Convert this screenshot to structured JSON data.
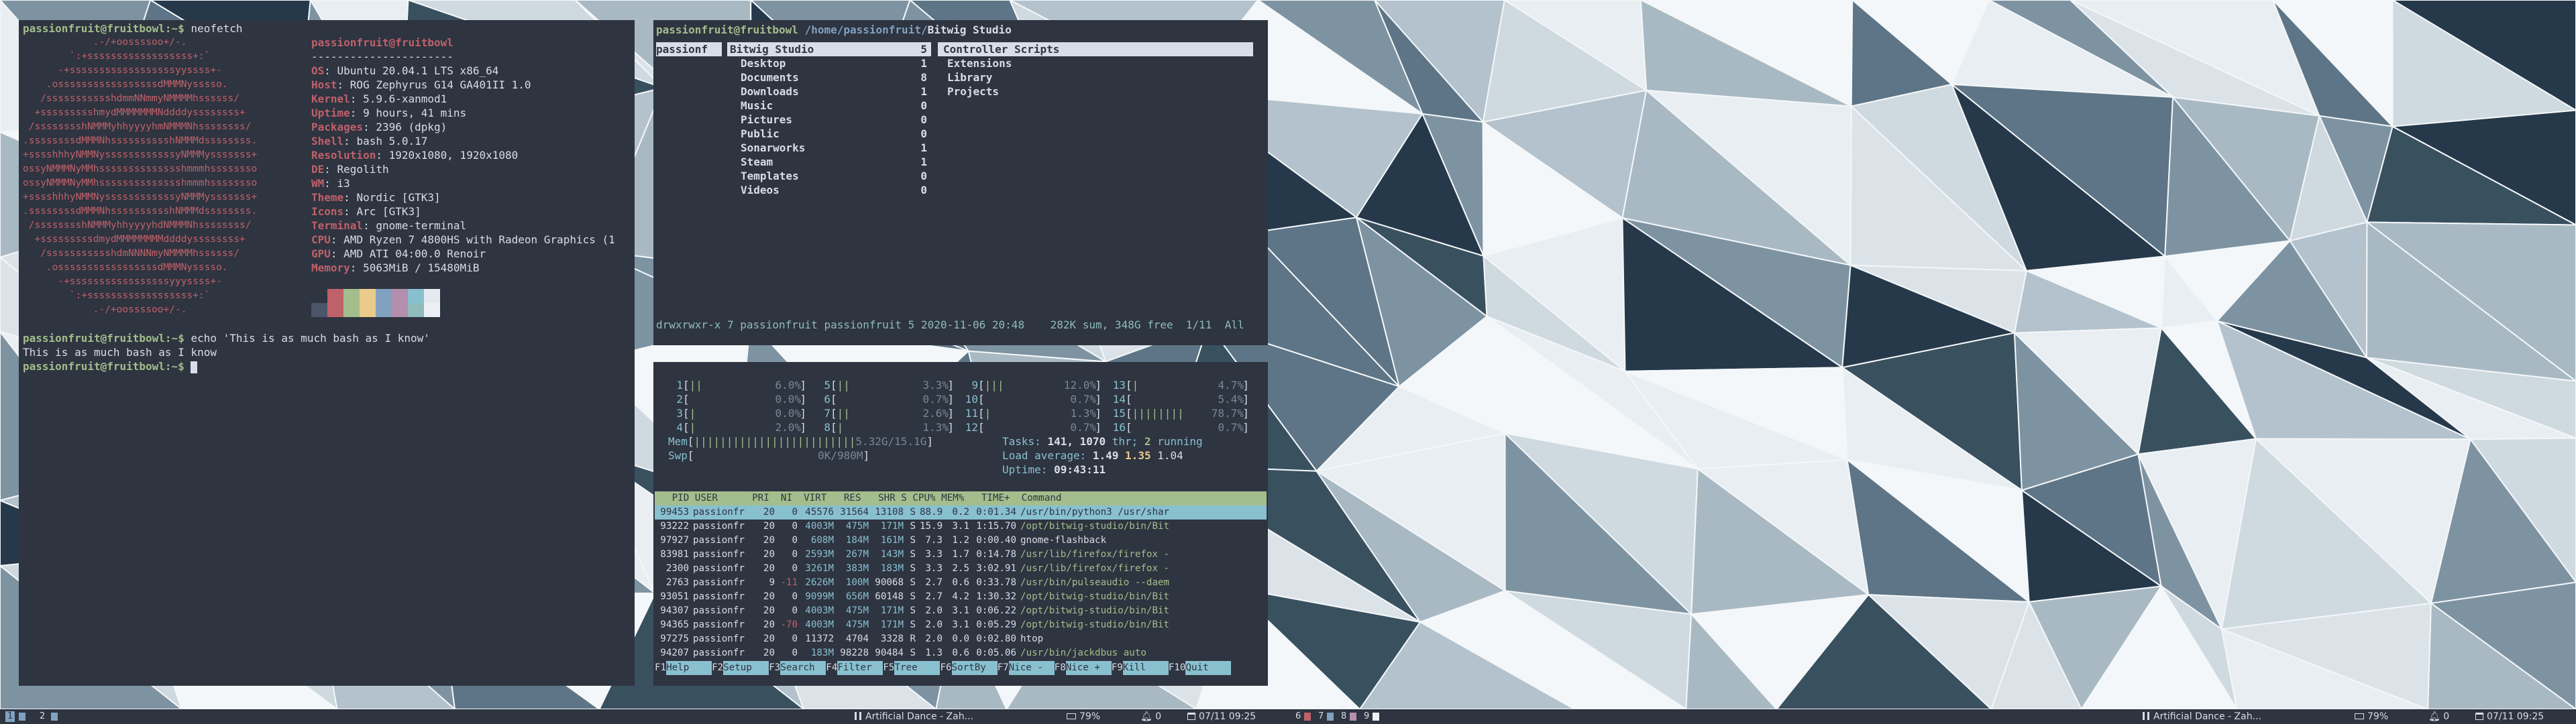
{
  "colors": {
    "bg": "#2e3440",
    "fg": "#d8dee9",
    "green": "#a3be8c",
    "red": "#bf616a",
    "cyan": "#88c0d0",
    "blue": "#81a1c1",
    "yellow": "#ebcb8b",
    "magenta": "#b48ead"
  },
  "terminal": {
    "prompt": "passionfruit@fruitbowl:~$ ",
    "cmd1": "neofetch",
    "logo": [
      "            .-/+oossssoo+/-.",
      "        `:+ssssssssssssssssss+:`",
      "      -+ssssssssssssssssssyyssss+-",
      "    .osssssssssssssssssdMMMNysssso.",
      "   /ssssssssssshdmmNNmmyNMMMMhssssss/",
      "  +ssssssssshmydMMMMMMMNddddyssssssss+",
      " /sssssssshNMMMyhhyyyyhmNMMMNhssssssss/",
      ".ssssssssdMMMNhsssssssssshNMMMdssssssss.",
      "+sssshhhyNMMNyssssssssssssyNMMMysssssss+",
      "ossyNMMMNyMMhsssssssssssssshmmmhssssssso",
      "ossyNMMMNyMMhsssssssssssssshmmmhssssssso",
      "+sssshhhyNMMNyssssssssssssyNMMMysssssss+",
      ".ssssssssdMMMNhsssssssssshNMMMdssssssss.",
      " /sssssssshNMMMyhhyyyyhdNMMMNhssssssss/",
      "  +sssssssssdmydMMMMMMMMddddyssssssss+",
      "   /ssssssssssshdmNNNNmyNMMMMhssssss/",
      "    .osssssssssssssssssdMMMNysssso.",
      "      -+sssssssssssssssssyyyssss+-",
      "        `:+ssssssssssssssssss+:`",
      "            .-/+oossssoo+/-."
    ],
    "header": "passionfruit@fruitbowl",
    "separator": "----------------------",
    "info": [
      {
        "key": "OS",
        "value": "Ubuntu 20.04.1 LTS x86_64"
      },
      {
        "key": "Host",
        "value": "ROG Zephyrus G14 GA401II 1.0"
      },
      {
        "key": "Kernel",
        "value": "5.9.6-xanmod1"
      },
      {
        "key": "Uptime",
        "value": "9 hours, 41 mins"
      },
      {
        "key": "Packages",
        "value": "2396 (dpkg)"
      },
      {
        "key": "Shell",
        "value": "bash 5.0.17"
      },
      {
        "key": "Resolution",
        "value": "1920x1080, 1920x1080"
      },
      {
        "key": "DE",
        "value": "Regolith"
      },
      {
        "key": "WM",
        "value": "i3"
      },
      {
        "key": "Theme",
        "value": "Nordic [GTK3]"
      },
      {
        "key": "Icons",
        "value": "Arc [GTK3]"
      },
      {
        "key": "Terminal",
        "value": "gnome-terminal"
      },
      {
        "key": "CPU",
        "value": "AMD Ryzen 7 4800HS with Radeon Graphics (1"
      },
      {
        "key": "GPU",
        "value": "AMD ATI 04:00.0 Renoir"
      },
      {
        "key": "Memory",
        "value": "5063MiB / 15480MiB"
      }
    ],
    "palette_top": [
      "#2e3440",
      "#bf616a",
      "#a3be8c",
      "#ebcb8b",
      "#81a1c1",
      "#b48ead",
      "#88c0d0",
      "#e5e9f0"
    ],
    "palette_bottom": [
      "#4c566a",
      "#bf616a",
      "#a3be8c",
      "#ebcb8b",
      "#81a1c1",
      "#b48ead",
      "#8fbcbb",
      "#eceff4"
    ],
    "cmd2": "echo 'This is as much bash as I know'",
    "output2": "This is as much bash as I know"
  },
  "ranger": {
    "title_host": "passionfruit@fruitbowl",
    "title_path": "/home/passionfruit/",
    "title_sel": "Bitwig Studio",
    "col1": "passionf",
    "col2": [
      {
        "name": "Bitwig Studio",
        "count": "5"
      },
      {
        "name": "Desktop",
        "count": "1"
      },
      {
        "name": "Documents",
        "count": "8"
      },
      {
        "name": "Downloads",
        "count": "1"
      },
      {
        "name": "Music",
        "count": "0"
      },
      {
        "name": "Pictures",
        "count": "0"
      },
      {
        "name": "Public",
        "count": "0"
      },
      {
        "name": "Sonarworks",
        "count": "1"
      },
      {
        "name": "Steam",
        "count": "1"
      },
      {
        "name": "Templates",
        "count": "0"
      },
      {
        "name": "Videos",
        "count": "0"
      }
    ],
    "col3": [
      "Controller Scripts",
      "Extensions",
      "Library",
      "Projects"
    ],
    "status": "drwxrwxr-x 7 passionfruit passionfruit 5 2020-11-06 20:48    282K sum, 348G free  1/11  All"
  },
  "htop": {
    "cpus": [
      {
        "n": "1",
        "bar": "||",
        "pct": "6.0%"
      },
      {
        "n": "2",
        "bar": "",
        "pct": "0.0%"
      },
      {
        "n": "3",
        "bar": "|",
        "pct": "0.0%"
      },
      {
        "n": "4",
        "bar": "|",
        "pct": "2.0%"
      },
      {
        "n": "5",
        "bar": "||",
        "pct": "3.3%"
      },
      {
        "n": "6",
        "bar": "",
        "pct": "0.7%"
      },
      {
        "n": "7",
        "bar": "||",
        "pct": "2.6%"
      },
      {
        "n": "8",
        "bar": "|",
        "pct": "1.3%"
      },
      {
        "n": "9",
        "bar": "|||",
        "pct": "12.0%"
      },
      {
        "n": "10",
        "bar": "",
        "pct": "0.7%"
      },
      {
        "n": "11",
        "bar": "|",
        "pct": "1.3%"
      },
      {
        "n": "12",
        "bar": "",
        "pct": "0.7%"
      },
      {
        "n": "13",
        "bar": "|",
        "pct": "4.7%"
      },
      {
        "n": "14",
        "bar": "",
        "pct": "5.4%"
      },
      {
        "n": "15",
        "bar": "||||||||",
        "pct": "78.7%"
      },
      {
        "n": "16",
        "bar": "",
        "pct": "0.7%"
      }
    ],
    "mem_label": "Mem",
    "mem_bar": "|||||||||||||||||||||||||",
    "mem_val": "5.32G/15.1G",
    "swp_label": "Swp",
    "swp_bar": "",
    "swp_val": "0K/980M",
    "tasks_label": "Tasks:",
    "tasks_val": "141,",
    "thr_val": "1070",
    "thr_label": "thr;",
    "running_val": "2",
    "running_label": "running",
    "load_label": "Load average:",
    "load1": "1.49",
    "load5": "1.35",
    "load15": "1.04",
    "uptime_label": "Uptime:",
    "uptime_val": "09:43:11",
    "header": "   PID USER      PRI  NI  VIRT   RES   SHR S CPU% MEM%   TIME+  Command",
    "rows": [
      {
        "pid": "99453",
        "user": "passionfr",
        "pri": "20",
        "ni": "0",
        "virt": "45576",
        "res": "31564",
        "shr": "13108",
        "s": "S",
        "cpu": "88.9",
        "mem": "0.2",
        "time": "0:01.34",
        "cmd": "/usr/bin/python3 /usr/shar"
      },
      {
        "pid": "93222",
        "user": "passionfr",
        "pri": "20",
        "ni": "0",
        "virt": "4003M",
        "res": "475M",
        "shr": "171M",
        "s": "S",
        "cpu": "15.9",
        "mem": "3.1",
        "time": "1:15.70",
        "cmd": "/opt/bitwig-studio/bin/Bit"
      },
      {
        "pid": "97927",
        "user": "passionfr",
        "pri": "20",
        "ni": "0",
        "virt": "608M",
        "res": "184M",
        "shr": "161M",
        "s": "S",
        "cpu": "7.3",
        "mem": "1.2",
        "time": "0:00.40",
        "cmd": "gnome-flashback"
      },
      {
        "pid": "83981",
        "user": "passionfr",
        "pri": "20",
        "ni": "0",
        "virt": "2593M",
        "res": "267M",
        "shr": "143M",
        "s": "S",
        "cpu": "3.3",
        "mem": "1.7",
        "time": "0:14.78",
        "cmd": "/usr/lib/firefox/firefox -"
      },
      {
        "pid": "2300",
        "user": "passionfr",
        "pri": "20",
        "ni": "0",
        "virt": "3261M",
        "res": "383M",
        "shr": "183M",
        "s": "S",
        "cpu": "3.3",
        "mem": "2.5",
        "time": "3:02.91",
        "cmd": "/usr/lib/firefox/firefox -"
      },
      {
        "pid": "2763",
        "user": "passionfr",
        "pri": "9",
        "ni": "-11",
        "virt": "2626M",
        "res": "100M",
        "shr": "90068",
        "s": "S",
        "cpu": "2.7",
        "mem": "0.6",
        "time": "0:33.78",
        "cmd": "/usr/bin/pulseaudio --daem"
      },
      {
        "pid": "93051",
        "user": "passionfr",
        "pri": "20",
        "ni": "0",
        "virt": "9099M",
        "res": "656M",
        "shr": "60148",
        "s": "S",
        "cpu": "2.7",
        "mem": "4.2",
        "time": "1:30.32",
        "cmd": "/opt/bitwig-studio/bin/Bit"
      },
      {
        "pid": "94307",
        "user": "passionfr",
        "pri": "20",
        "ni": "0",
        "virt": "4003M",
        "res": "475M",
        "shr": "171M",
        "s": "S",
        "cpu": "2.0",
        "mem": "3.1",
        "time": "0:06.22",
        "cmd": "/opt/bitwig-studio/bin/Bit"
      },
      {
        "pid": "94365",
        "user": "passionfr",
        "pri": "20",
        "ni": "-70",
        "virt": "4003M",
        "res": "475M",
        "shr": "171M",
        "s": "S",
        "cpu": "2.0",
        "mem": "3.1",
        "time": "0:05.29",
        "cmd": "/opt/bitwig-studio/bin/Bit"
      },
      {
        "pid": "97275",
        "user": "passionfr",
        "pri": "20",
        "ni": "0",
        "virt": "11372",
        "res": "4704",
        "shr": "3328",
        "s": "R",
        "cpu": "2.0",
        "mem": "0.0",
        "time": "0:02.80",
        "cmd": "htop"
      },
      {
        "pid": "94207",
        "user": "passionfr",
        "pri": "20",
        "ni": "0",
        "virt": "183M",
        "res": "98228",
        "shr": "90484",
        "s": "S",
        "cpu": "1.3",
        "mem": "0.6",
        "time": "0:05.06",
        "cmd": "/usr/bin/jackdbus auto"
      }
    ],
    "fkeys": [
      {
        "k": "F1",
        "l": "Help  "
      },
      {
        "k": "F2",
        "l": "Setup "
      },
      {
        "k": "F3",
        "l": "Search"
      },
      {
        "k": "F4",
        "l": "Filter"
      },
      {
        "k": "F5",
        "l": "Tree  "
      },
      {
        "k": "F6",
        "l": "SortBy"
      },
      {
        "k": "F7",
        "l": "Nice -"
      },
      {
        "k": "F8",
        "l": "Nice +"
      },
      {
        "k": "F9",
        "l": "Kill  "
      },
      {
        "k": "F10",
        "l": "Quit  "
      }
    ]
  },
  "bar_left": {
    "ws": [
      {
        "label": "1",
        "active": true
      },
      {
        "label": "2",
        "active": false
      }
    ],
    "music": "Artificial Dance - Zah...",
    "volume": "79%",
    "notifications": "0",
    "clock": "07/11 09:25"
  },
  "bar_right": {
    "ws": [
      {
        "label": "6",
        "color": "#bf616a"
      },
      {
        "label": "7",
        "color": "#81a1c1"
      },
      {
        "label": "8",
        "color": "#b48ead"
      },
      {
        "label": "9",
        "color": "#eceff4"
      }
    ],
    "music": "Artificial Dance - Zah...",
    "volume": "79%",
    "notifications": "0",
    "clock": "07/11 09:25"
  },
  "icons": {
    "pause": "pause-icon",
    "battery": "battery-icon",
    "bell": "bell-icon",
    "calendar": "calendar-icon"
  }
}
